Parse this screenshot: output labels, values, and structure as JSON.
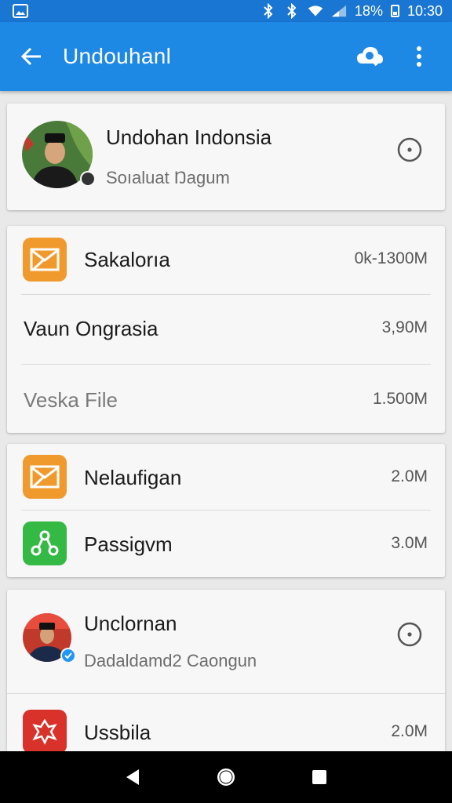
{
  "status_bar": {
    "battery_percent": "18%",
    "time": "10:30"
  },
  "app_bar": {
    "title": "Undouhanl"
  },
  "profile_card": {
    "name": "Undohan Indonsia",
    "subtitle": "Soıaluat Ŋagum"
  },
  "group_one": {
    "items": [
      {
        "label": "Sakalorıa",
        "size": "0k-1300M"
      },
      {
        "label": "Vaun Ongrasia",
        "size": "3,90M"
      },
      {
        "label": "Veska File",
        "size": "1.500M"
      }
    ]
  },
  "group_two": {
    "items": [
      {
        "label": "Nelaufigan",
        "size": "2.0M"
      },
      {
        "label": "Passigvm",
        "size": "3.0M"
      }
    ]
  },
  "contact_card": {
    "name": "Unclornan",
    "subtitle": "Dadaldamd2 Caongun",
    "app_label": "Ussbila",
    "app_size": "2.0M"
  },
  "colors": {
    "status_bar": "#1976d2",
    "app_bar": "#1e88e5",
    "mail_orange": "#f09a2e",
    "share_green": "#34b944",
    "red_app": "#d8322a",
    "verified_blue": "#2196f3"
  }
}
